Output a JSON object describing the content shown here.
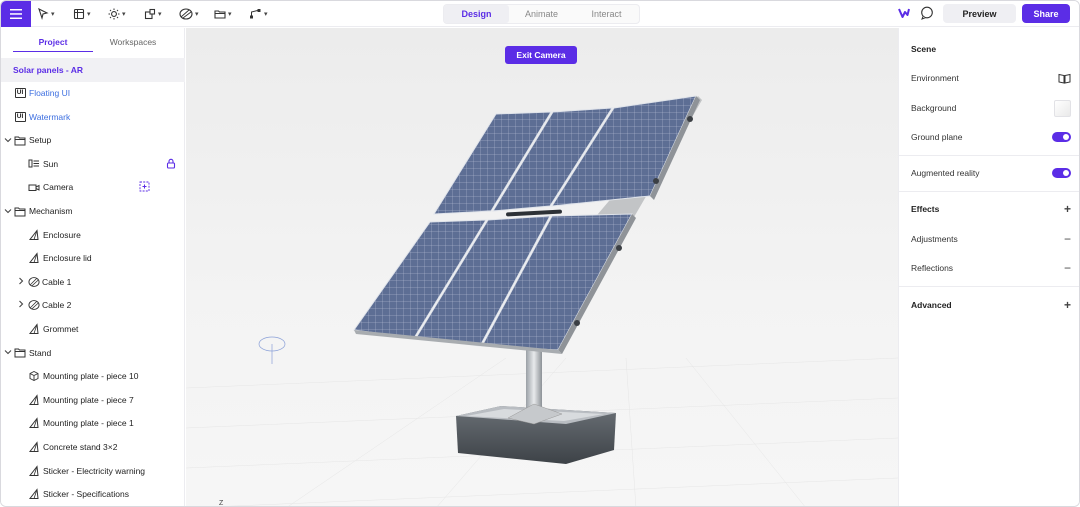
{
  "app": {
    "accent": "#5b2de6",
    "toolbar": {
      "tools": [
        {
          "icon": "pointer-tool-icon"
        },
        {
          "icon": "frame-tool-icon"
        },
        {
          "icon": "light-tool-icon"
        },
        {
          "icon": "shape-tool-icon"
        },
        {
          "icon": "material-tool-icon"
        },
        {
          "icon": "folder-tool-icon"
        },
        {
          "icon": "path-tool-icon"
        }
      ],
      "modes": [
        "Design",
        "Animate",
        "Interact"
      ],
      "active_mode": "Design",
      "preview_label": "Preview",
      "share_label": "Share"
    },
    "left_panel": {
      "tabs": [
        "Project",
        "Workspaces"
      ],
      "active_tab": "Project",
      "project_name": "Solar panels - AR",
      "tree": [
        {
          "label": "Floating UI",
          "icon": "ui-icon",
          "depth": 0,
          "link": true
        },
        {
          "label": "Watermark",
          "icon": "ui-icon",
          "depth": 0,
          "link": true
        },
        {
          "label": "Setup",
          "icon": "folder-icon",
          "depth": 0,
          "expand": "open"
        },
        {
          "label": "Sun",
          "icon": "light-icon",
          "depth": 1,
          "trail": "lock-icon"
        },
        {
          "label": "Camera",
          "icon": "camera-icon",
          "depth": 1,
          "trail": "target-icon"
        },
        {
          "label": "Mechanism",
          "icon": "folder-icon",
          "depth": 0,
          "expand": "open"
        },
        {
          "label": "Enclosure",
          "icon": "mesh-icon",
          "depth": 1
        },
        {
          "label": "Enclosure lid",
          "icon": "mesh-icon",
          "depth": 1
        },
        {
          "label": "Cable 1",
          "icon": "cable-icon",
          "depth": 1,
          "expand": "closed"
        },
        {
          "label": "Cable 2",
          "icon": "cable-icon",
          "depth": 1,
          "expand": "closed"
        },
        {
          "label": "Grommet",
          "icon": "mesh-icon",
          "depth": 1
        },
        {
          "label": "Stand",
          "icon": "folder-icon",
          "depth": 0,
          "expand": "open"
        },
        {
          "label": "Mounting plate - piece 10",
          "icon": "cube-icon",
          "depth": 1
        },
        {
          "label": "Mounting plate - piece 7",
          "icon": "mesh-icon",
          "depth": 1
        },
        {
          "label": "Mounting plate - piece 1",
          "icon": "mesh-icon",
          "depth": 1
        },
        {
          "label": "Concrete stand 3×2",
          "icon": "mesh-icon",
          "depth": 1
        },
        {
          "label": "Sticker - Electricity warning",
          "icon": "mesh-icon",
          "depth": 1
        },
        {
          "label": "Sticker - Specifications",
          "icon": "mesh-icon",
          "depth": 1
        }
      ]
    },
    "viewport": {
      "exit_camera_label": "Exit Camera",
      "axis_label": "Z"
    },
    "right_panel": {
      "scene_title": "Scene",
      "environment_label": "Environment",
      "background_label": "Background",
      "ground_plane_label": "Ground plane",
      "ground_plane_on": true,
      "ar_label": "Augmented reality",
      "ar_on": true,
      "effects_label": "Effects",
      "adjustments_label": "Adjustments",
      "reflections_label": "Reflections",
      "advanced_label": "Advanced"
    }
  }
}
